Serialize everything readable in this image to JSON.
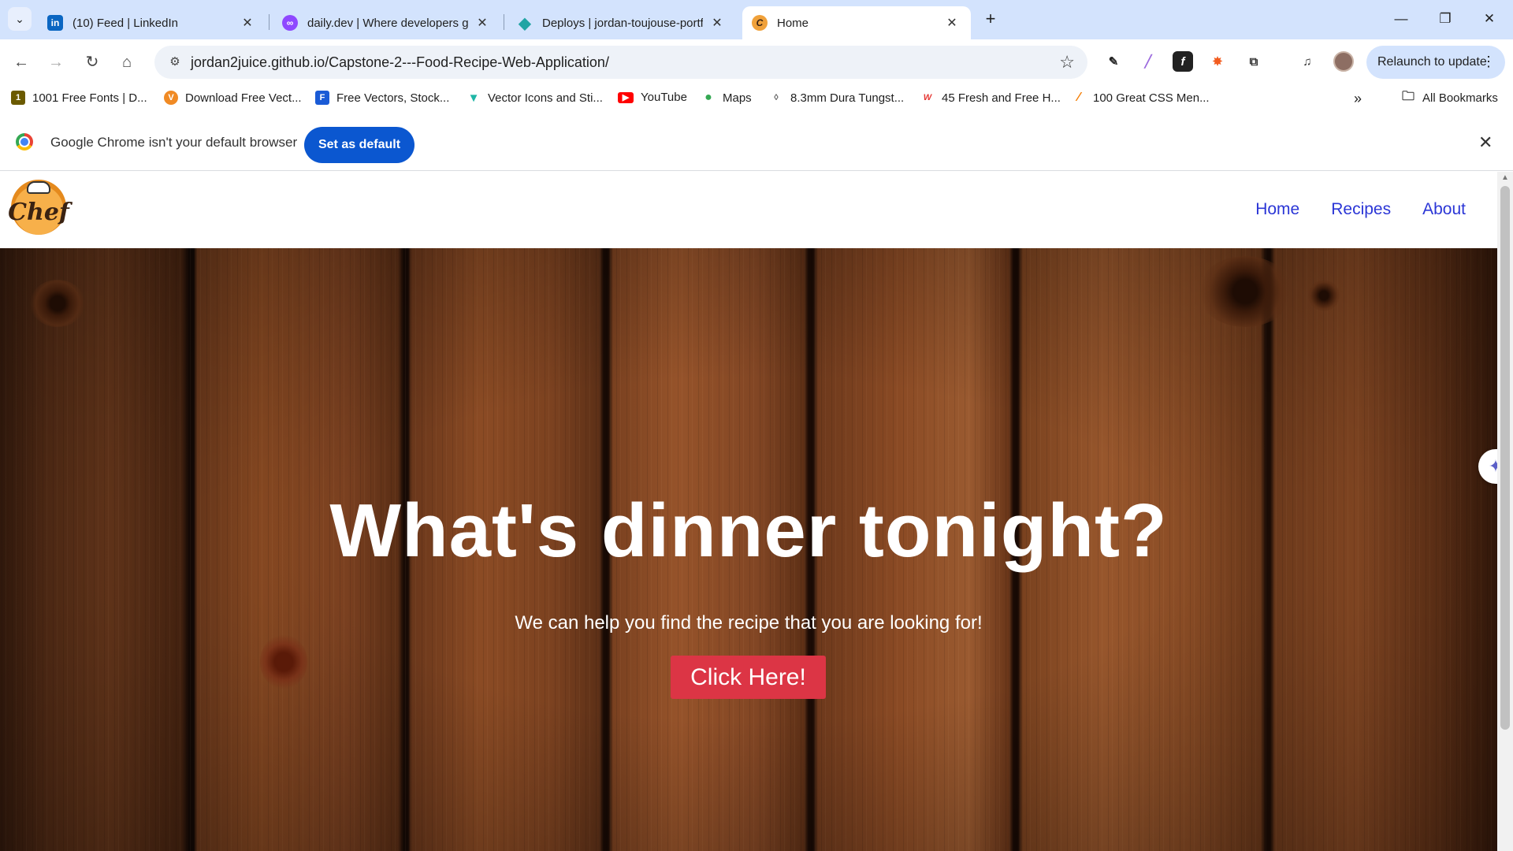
{
  "browser": {
    "tabs": [
      {
        "title": "(10) Feed | LinkedIn",
        "favicon": "linkedin-icon",
        "color": "#0a66c2",
        "glyph": "in"
      },
      {
        "title": "daily.dev | Where developers gr",
        "favicon": "dailydev-icon",
        "color": "#8e48ff",
        "glyph": "d"
      },
      {
        "title": "Deploys | jordan-toujouse-portf",
        "favicon": "netlify-icon",
        "color": "#20a4a4",
        "glyph": "◆"
      },
      {
        "title": "Home",
        "favicon": "chef-icon",
        "color": "#f0a13a",
        "glyph": "C",
        "active": true
      }
    ],
    "url": "jordan2juice.github.io/Capstone-2---Food-Recipe-Web-Application/",
    "relaunch_label": "Relaunch to update",
    "bookmarks": [
      {
        "label": "1001 Free Fonts | D...",
        "icon": "fonts-icon",
        "color": "#6b5a00",
        "glyph": "1"
      },
      {
        "label": "Download Free Vect...",
        "icon": "vecteezy-icon",
        "color": "#f08a24",
        "glyph": "V"
      },
      {
        "label": "Free Vectors, Stock...",
        "icon": "freepik-icon",
        "color": "#1a5bd6",
        "glyph": "F"
      },
      {
        "label": "Vector Icons and Sti...",
        "icon": "flaticon-icon",
        "color": "#1fb6a6",
        "glyph": "▼"
      },
      {
        "label": "YouTube",
        "icon": "youtube-icon",
        "color": "#ff0000",
        "glyph": "▶"
      },
      {
        "label": "Maps",
        "icon": "maps-icon",
        "color": "#34a853",
        "glyph": "●"
      },
      {
        "label": "8.3mm Dura Tungst...",
        "icon": "ring-icon",
        "color": "#555555",
        "glyph": "◊"
      },
      {
        "label": "45 Fresh and Free H...",
        "icon": "webdesign-icon",
        "color": "#e53935",
        "glyph": "W"
      },
      {
        "label": "100 Great CSS Men...",
        "icon": "css-icon",
        "color": "#f57c00",
        "glyph": "/"
      }
    ],
    "all_bookmarks_label": "All Bookmarks",
    "infobar": {
      "message": "Google Chrome isn't your default browser",
      "button_label": "Set as default"
    }
  },
  "site": {
    "logo_text": "Chef",
    "nav": [
      "Home",
      "Recipes",
      "About"
    ],
    "hero": {
      "title": "What's dinner tonight?",
      "subtitle": "We can help you find the recipe that you are looking for!",
      "cta_label": "Click Here!"
    }
  },
  "colors": {
    "nav_link": "#2b36d6",
    "cta": "#dc3545",
    "chrome_accent": "#0b57d0",
    "tabstrip": "#d3e3fd"
  }
}
